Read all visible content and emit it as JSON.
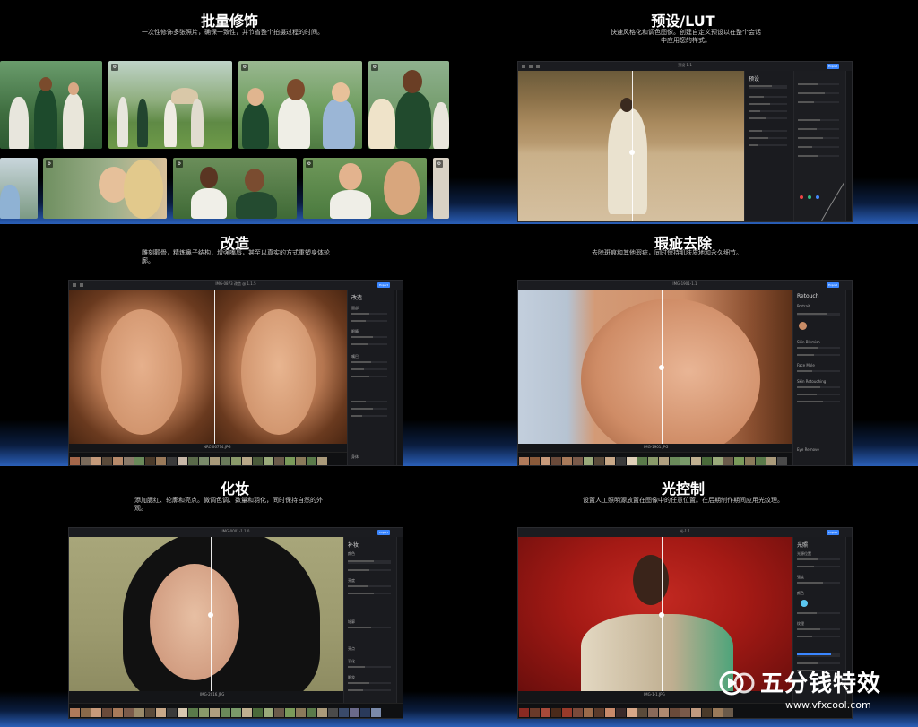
{
  "panels": {
    "batch": {
      "title": "批量修饰",
      "desc": "一次性修饰多张照片，确保一致性，并节省整个拍摄过程的时间。"
    },
    "presets": {
      "title": "预设/LUT",
      "desc": "快速风格化和调色图像。创建自定义预设以在整个会话中应用您的样式。"
    },
    "reshape": {
      "title": "改造",
      "desc": "雕刻颧骨，精炼鼻子结构，增强嘴唇，甚至以真实的方式重塑身体轮廓。"
    },
    "blemish": {
      "title": "瑕疵去除",
      "desc": "去除斑痕和其他瑕疵，同时保持肌肤质地和永久细节。"
    },
    "makeup": {
      "title": "化妆",
      "desc": "添加腮红、轮廓和亮点。微调色调、数量和羽化，同时保持自然的外观。"
    },
    "light": {
      "title": "光控制",
      "desc": "设置人工照明源放置在图像中的任意位置。在后期制作期间应用光纹理。"
    }
  },
  "windows": {
    "presets": {
      "title": "预设-1.1",
      "panel_header": "预设",
      "save": "Export"
    },
    "reshape": {
      "title": "IMG-0873 改造 @ 1.1.5",
      "panel_header": "改造",
      "save": "Export",
      "labels": [
        "面部",
        "眼睛",
        "嘴巴",
        "身体"
      ],
      "footer": "NRC-06774.JPG"
    },
    "blemish": {
      "title": "IMG-1901-1.1",
      "panel_header": "Retouch",
      "save": "Export",
      "labels": [
        "Portrait",
        "Skin Blemish",
        "Face Mole",
        "Skin Retouching",
        "Eye Remove"
      ],
      "footer": "IMG-1901.JPG"
    },
    "makeup": {
      "title": "IMG-0001-1.1.0",
      "panel_header": "补妆",
      "save": "Export",
      "labels": [
        "颜色",
        "亮度",
        "轮廓",
        "亮点",
        "羽化",
        "眼妆"
      ],
      "footer": "IMG-2016.JPG"
    },
    "light": {
      "title": "光-1.1",
      "panel_header": "光照",
      "save": "Export",
      "labels": [
        "光源位置",
        "强度",
        "颜色",
        "纹理"
      ],
      "footer": "IMG-1-1.JPG"
    }
  },
  "watermark": {
    "name": "五分钱特效",
    "url": "www.vfxcool.com"
  }
}
